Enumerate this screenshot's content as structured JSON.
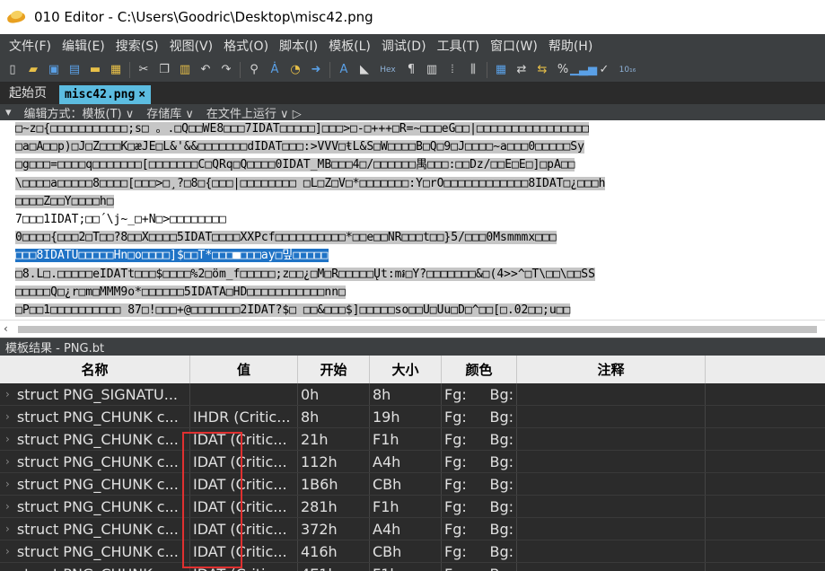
{
  "window": {
    "title": "010 Editor - C:\\Users\\Goodric\\Desktop\\misc42.png"
  },
  "menu": [
    "文件(F)",
    "编辑(E)",
    "搜索(S)",
    "视图(V)",
    "格式(O)",
    "脚本(I)",
    "模板(L)",
    "调试(D)",
    "工具(T)",
    "窗口(W)",
    "帮助(H)"
  ],
  "toolbar": {
    "hex_label": "Hex"
  },
  "tabs": {
    "start": "起始页",
    "file": "misc42.png",
    "close": "×"
  },
  "subbar": {
    "toggle": "▾",
    "edit_mode": "编辑方式：模板(T) ∨",
    "repo": "存储库 ∨",
    "run": "在文件上运行 ∨ ▷"
  },
  "hex_lines": [
    "□~z□{□□□□□□□□□□□;s□ 。.□Q□□WE8□□□7IDAT□□□□□]□□□>□-□+++□R=~□□□eG□□|□□□□□□□□□□□□□□□□",
    "□a□A□□p)□J□Z□□□K□æJE□L&'&&□□□□□□□dIDAT□□□:>VVV□ŧL&S□W□□□□B□Q□9□J□□□□~a□□□0□□□□□Sy",
    "□g□□□=□□□□q□□□□□□□[□□□□□□□C□QRq□Q□□□□0IDAT_MB□□□4□/□□□□□□禺□□□:□□Dz/□□E□E□]□pA□□",
    "\\□□□□a□□□□□8□□□□[□□□>□¸?□8□{□□□|□□□□□□□□ □L□Z□V□*□□□□□□□:Y□rO□□□□□□□□□□□□8IDAT□¿□□□h",
    "□□□□Z□□Y□□□□h□",
    "7□□□1IDAT;□□´\\j~_□+N□>□□□□□□□□",
    "0□□□□{□□□2□T□□?8□□X□□□□5IDAT□□□□XXPcf□□□□□□□□□□*□□e□□NR□□□t□□}5/□□□0Msmmmx□□□",
    "□□□8IDATU□□□□□Hn□o□□□□]$□□T*□□□■□□□ay□밒□□□□□",
    "□8.L□.□□□□□eIDATt□□□$□□□□%2□öm_f□□□□□;z□□¿□M□R□□□□□Ųt:m៛□Y?□□□□□□□&□(4>>^□T\\□□\\□□SS",
    "□□□□□Q□¿r□m□MMM9o*□□□□□□5IDATA□HD□□□□□□□□□□□nn□",
    "□P□□1□□□□□□□□□□ 87□!□□□+@□□□□□□□2IDAT?$□ □□&□□□$]□□□□□so□□U□Uu□D□^□□[□.02□□;u□□"
  ],
  "panel": {
    "title": "模板结果 - PNG.bt"
  },
  "table": {
    "headers": [
      "名称",
      "值",
      "开始",
      "大小",
      "颜色",
      "注释"
    ],
    "rows": [
      {
        "name": "struct PNG_SIGNATU...",
        "value": "",
        "start": "0h",
        "size": "8h",
        "fg": "Fg:",
        "bg": "Bg:"
      },
      {
        "name": "struct PNG_CHUNK c...",
        "value": "IHDR  (Critic...",
        "start": "8h",
        "size": "19h",
        "fg": "Fg:",
        "bg": "Bg:"
      },
      {
        "name": "struct PNG_CHUNK c...",
        "value": "IDAT  (Critic...",
        "start": "21h",
        "size": "F1h",
        "fg": "Fg:",
        "bg": "Bg:"
      },
      {
        "name": "struct PNG_CHUNK c...",
        "value": "IDAT  (Critic...",
        "start": "112h",
        "size": "A4h",
        "fg": "Fg:",
        "bg": "Bg:"
      },
      {
        "name": "struct PNG_CHUNK c...",
        "value": "IDAT  (Critic...",
        "start": "1B6h",
        "size": "CBh",
        "fg": "Fg:",
        "bg": "Bg:"
      },
      {
        "name": "struct PNG_CHUNK c...",
        "value": "IDAT  (Critic...",
        "start": "281h",
        "size": "F1h",
        "fg": "Fg:",
        "bg": "Bg:"
      },
      {
        "name": "struct PNG_CHUNK c...",
        "value": "IDAT  (Critic...",
        "start": "372h",
        "size": "A4h",
        "fg": "Fg:",
        "bg": "Bg:"
      },
      {
        "name": "struct PNG_CHUNK c...",
        "value": "IDAT  (Critic...",
        "start": "416h",
        "size": "CBh",
        "fg": "Fg:",
        "bg": "Bg:"
      },
      {
        "name": "struct PNG_CHUNK c...",
        "value": "IDAT  (Critic...",
        "start": "4E1h",
        "size": "F1h",
        "fg": "Fg:",
        "bg": "Bg:"
      }
    ]
  },
  "colors": {
    "accent_tab": "#5cbce0",
    "selection_blue": "#1f73c6",
    "annotation_red": "#e03030"
  },
  "icons": [
    "new-file-icon",
    "open-folder-icon",
    "save-icon",
    "save-all-icon",
    "folder-icon",
    "cut-icon",
    "copy-icon",
    "paste-icon",
    "undo-icon",
    "redo-icon",
    "find-icon",
    "replace-icon",
    "goto-icon",
    "font-icon",
    "highlight-icon",
    "hex-icon",
    "paragraph-icon",
    "columns-icon",
    "binary-icon",
    "calculator-icon",
    "compare-icon",
    "swap-icon",
    "percent-icon",
    "histogram-icon",
    "checksum-icon",
    "base-convert-icon"
  ]
}
